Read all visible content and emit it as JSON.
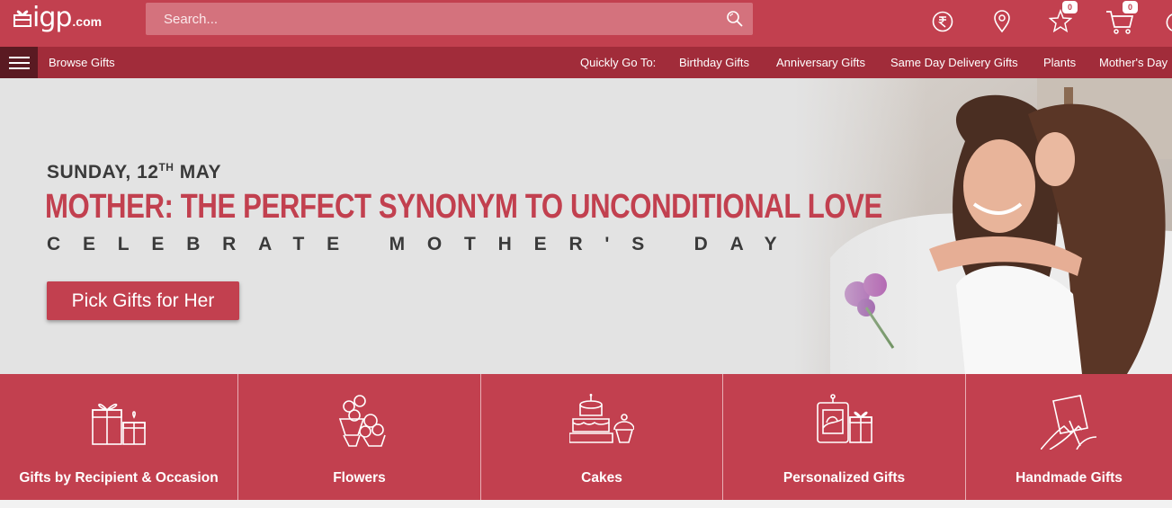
{
  "header": {
    "brand": "igp",
    "tld": ".com",
    "search_placeholder": "Search...",
    "cart_count": "0",
    "wishlist_count": "0",
    "icons": [
      "rupee-icon",
      "location-icon",
      "star-icon",
      "cart-icon"
    ]
  },
  "subnav": {
    "browse_label": "Browse Gifts",
    "quick_label": "Quickly Go To:",
    "links": [
      "Birthday Gifts",
      "Anniversary Gifts",
      "Same Day Delivery Gifts",
      "Plants",
      "Mother's Day"
    ]
  },
  "hero": {
    "date_prefix": "SUNDAY, 12",
    "date_sup": "TH",
    "date_suffix": " MAY",
    "headline": "MOTHER: THE PERFECT SYNONYM TO UNCONDITIONAL LOVE",
    "subheadline": "CELEBRATE MOTHER'S DAY",
    "cta_label": "Pick Gifts for Her"
  },
  "categories": [
    {
      "label": "Gifts by Recipient & Occasion",
      "icon": "gift-boxes-icon"
    },
    {
      "label": "Flowers",
      "icon": "flowers-icon"
    },
    {
      "label": "Cakes",
      "icon": "cake-icon"
    },
    {
      "label": "Personalized Gifts",
      "icon": "personalized-gift-icon"
    },
    {
      "label": "Handmade Gifts",
      "icon": "handmade-card-icon"
    }
  ],
  "colors": {
    "brand_red": "#c2404f",
    "nav_dark": "#a12c3a",
    "hero_bg": "#e3e3e3"
  }
}
